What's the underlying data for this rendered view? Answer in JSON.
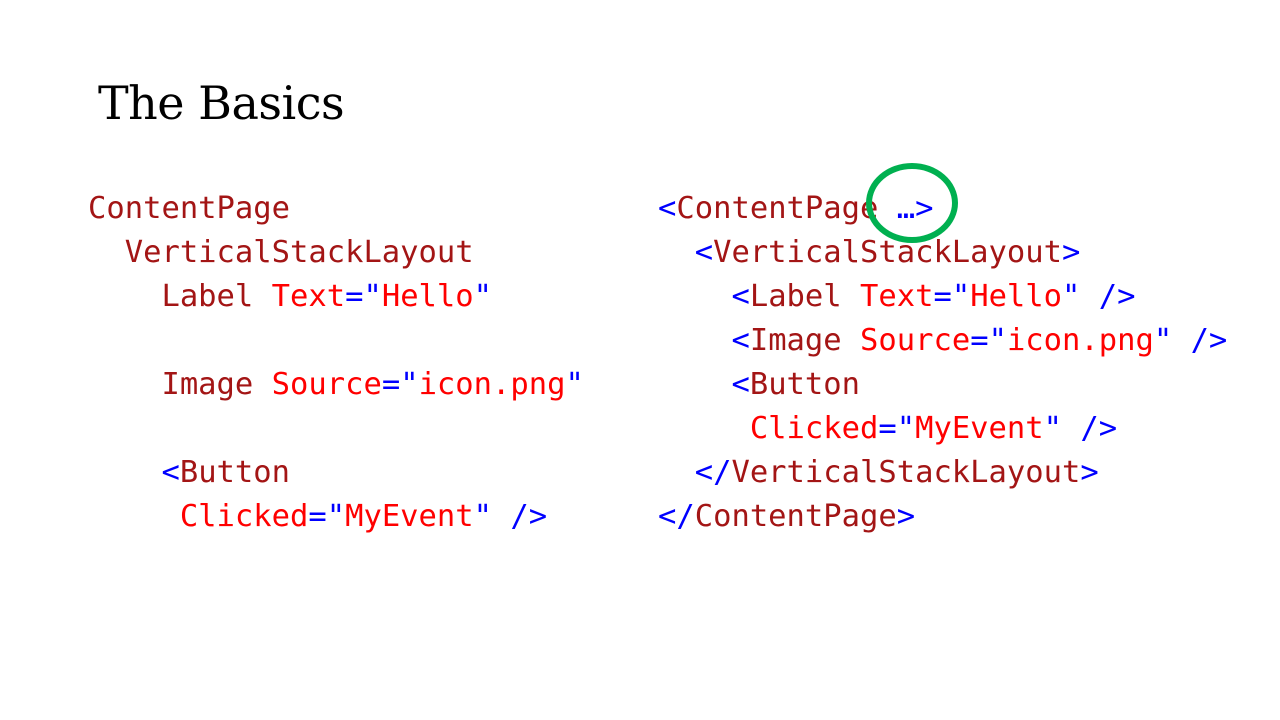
{
  "slide": {
    "title": "The Basics"
  },
  "left_code": [
    [
      {
        "t": "el",
        "text": "ContentPage"
      }
    ],
    [
      {
        "t": "el",
        "text": "  VerticalStackLayout"
      }
    ],
    [
      {
        "t": "el",
        "text": "    Label "
      },
      {
        "t": "at",
        "text": "Text"
      },
      {
        "t": "pu",
        "text": "=\""
      },
      {
        "t": "at",
        "text": "Hello"
      },
      {
        "t": "pu",
        "text": "\""
      }
    ],
    [],
    [
      {
        "t": "el",
        "text": "    Image "
      },
      {
        "t": "at",
        "text": "Source"
      },
      {
        "t": "pu",
        "text": "=\""
      },
      {
        "t": "at",
        "text": "icon.png"
      },
      {
        "t": "pu",
        "text": "\""
      }
    ],
    [],
    [
      {
        "t": "pu",
        "text": "    <"
      },
      {
        "t": "el",
        "text": "Button"
      }
    ],
    [
      {
        "t": "at",
        "text": "     Clicked"
      },
      {
        "t": "pu",
        "text": "=\""
      },
      {
        "t": "at",
        "text": "MyEvent"
      },
      {
        "t": "pu",
        "text": "\" />"
      }
    ]
  ],
  "right_code": [
    [
      {
        "t": "pu",
        "text": "<"
      },
      {
        "t": "el",
        "text": "ContentPage"
      },
      {
        "t": "pu",
        "text": " …>"
      }
    ],
    [
      {
        "t": "pu",
        "text": "  <"
      },
      {
        "t": "el",
        "text": "VerticalStackLayout"
      },
      {
        "t": "pu",
        "text": ">"
      }
    ],
    [
      {
        "t": "pu",
        "text": "    <"
      },
      {
        "t": "el",
        "text": "Label "
      },
      {
        "t": "at",
        "text": "Text"
      },
      {
        "t": "pu",
        "text": "=\""
      },
      {
        "t": "at",
        "text": "Hello"
      },
      {
        "t": "pu",
        "text": "\" />"
      }
    ],
    [
      {
        "t": "pu",
        "text": "    <"
      },
      {
        "t": "el",
        "text": "Image "
      },
      {
        "t": "at",
        "text": "Source"
      },
      {
        "t": "pu",
        "text": "=\""
      },
      {
        "t": "at",
        "text": "icon.png"
      },
      {
        "t": "pu",
        "text": "\" />"
      }
    ],
    [
      {
        "t": "pu",
        "text": "    <"
      },
      {
        "t": "el",
        "text": "Button"
      }
    ],
    [
      {
        "t": "at",
        "text": "     Clicked"
      },
      {
        "t": "pu",
        "text": "=\""
      },
      {
        "t": "at",
        "text": "MyEvent"
      },
      {
        "t": "pu",
        "text": "\" />"
      }
    ],
    [
      {
        "t": "pu",
        "text": "  </"
      },
      {
        "t": "el",
        "text": "VerticalStackLayout"
      },
      {
        "t": "pu",
        "text": ">"
      }
    ],
    [
      {
        "t": "pu",
        "text": "</"
      },
      {
        "t": "el",
        "text": "ContentPage"
      },
      {
        "t": "pu",
        "text": ">"
      }
    ]
  ],
  "colors": {
    "element": "#a31515",
    "attribute": "#ff0000",
    "punctuation": "#0000ff",
    "highlight": "#00b050"
  }
}
